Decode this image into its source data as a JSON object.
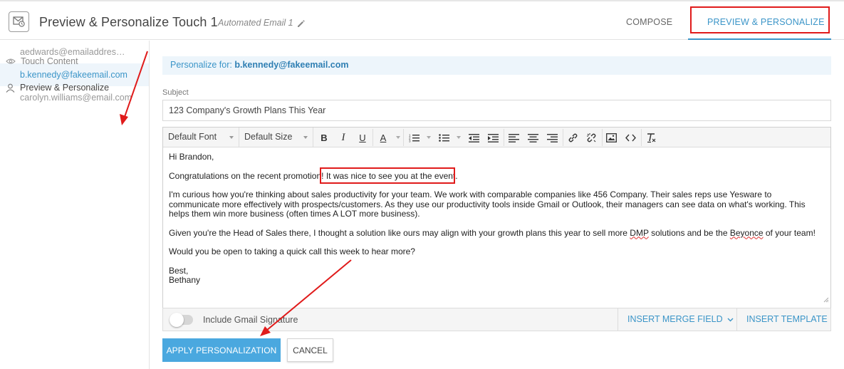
{
  "header": {
    "title": "Preview & Personalize Touch 1",
    "email_name": "Automated Email 1",
    "icon": "mail-clock-icon",
    "tabs": [
      {
        "label": "COMPOSE"
      },
      {
        "label": "PREVIEW & PERSONALIZE",
        "active": true
      }
    ]
  },
  "sidebar": {
    "touch_content": "Touch Content",
    "preview_personalize": "Preview & Personalize",
    "contacts": [
      {
        "email": "aedwards@emailaddress.com"
      },
      {
        "email": "b.kennedy@fakeemail.com",
        "active": true
      },
      {
        "email": "carolyn.williams@email.com"
      }
    ]
  },
  "personalize": {
    "prefix": "Personalize for:",
    "email": "b.kennedy@fakeemail.com"
  },
  "subject": {
    "label": "Subject",
    "value": "123 Company's Growth Plans This Year"
  },
  "toolbar": {
    "font": "Default Font",
    "size": "Default Size"
  },
  "email_body": {
    "greeting": "Hi Brandon,",
    "line1_a": "Congratulations on the recent promotion!",
    "line1_b": "It was nice to see you at the event.",
    "para2": "I'm curious how you're thinking about sales productivity for your team. We work with comparable companies like 456 Company. Their sales reps use Yesware to communicate more effectively with prospects/customers. As they use our productivity tools inside Gmail or Outlook, their managers can see data on what's working. This helps them win more business (often times A LOT more business).",
    "para3_a": "Given you're the Head of Sales there, I thought a solution like ours may align with your growth plans this year to sell more ",
    "para3_dmp": "DMP",
    "para3_b": " solutions and be the ",
    "para3_beyonce": "Beyonce",
    "para3_c": " of your team!",
    "para4": "Would you be open to taking a quick call this week to hear more?",
    "signoff": "Best,",
    "signature": "Bethany"
  },
  "footer": {
    "gmail_signature_label": "Include Gmail Signature",
    "gmail_signature_on": false,
    "insert_merge_field": "INSERT MERGE FIELD",
    "insert_template": "INSERT TEMPLATE"
  },
  "actions": {
    "apply": "APPLY PERSONALIZATION",
    "cancel": "CANCEL"
  },
  "colors": {
    "accent": "#3b95c8",
    "annotation": "#e01b1b",
    "primary_button": "#4aa8df"
  }
}
